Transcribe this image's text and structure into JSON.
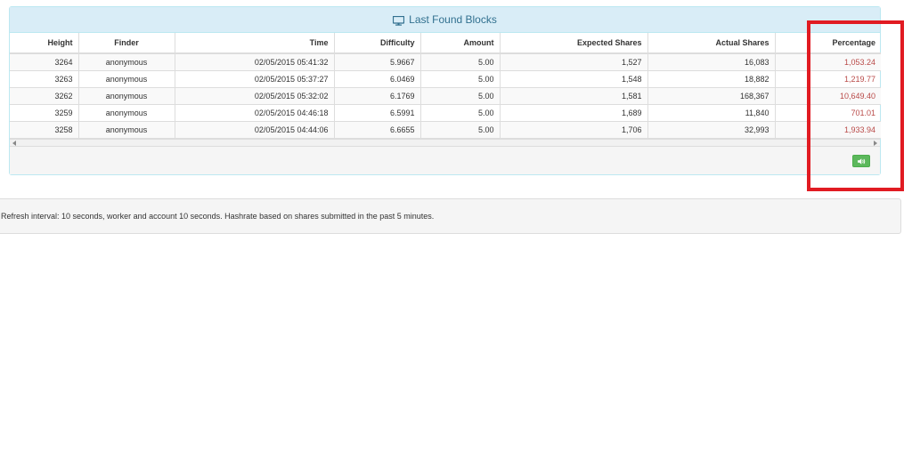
{
  "panel": {
    "title": "Last Found Blocks",
    "title_icon": "monitor-icon"
  },
  "table": {
    "columns": [
      "Height",
      "Finder",
      "Time",
      "Difficulty",
      "Amount",
      "Expected Shares",
      "Actual Shares",
      "Percentage"
    ],
    "rows": [
      {
        "height": "3264",
        "finder": "anonymous",
        "time": "02/05/2015 05:41:32",
        "difficulty": "5.9667",
        "amount": "5.00",
        "expected": "1,527",
        "actual": "16,083",
        "percentage": "1,053.24"
      },
      {
        "height": "3263",
        "finder": "anonymous",
        "time": "02/05/2015 05:37:27",
        "difficulty": "6.0469",
        "amount": "5.00",
        "expected": "1,548",
        "actual": "18,882",
        "percentage": "1,219.77"
      },
      {
        "height": "3262",
        "finder": "anonymous",
        "time": "02/05/2015 05:32:02",
        "difficulty": "6.1769",
        "amount": "5.00",
        "expected": "1,581",
        "actual": "168,367",
        "percentage": "10,649.40"
      },
      {
        "height": "3259",
        "finder": "anonymous",
        "time": "02/05/2015 04:46:18",
        "difficulty": "6.5991",
        "amount": "5.00",
        "expected": "1,689",
        "actual": "11,840",
        "percentage": "701.01"
      },
      {
        "height": "3258",
        "finder": "anonymous",
        "time": "02/05/2015 04:44:06",
        "difficulty": "6.6655",
        "amount": "5.00",
        "expected": "1,706",
        "actual": "32,993",
        "percentage": "1,933.94"
      }
    ]
  },
  "sound_button": {
    "icon": "speaker-icon"
  },
  "footer": {
    "text": "Refresh interval: 10 seconds, worker and account 10 seconds. Hashrate based on shares submitted in the past 5 minutes."
  },
  "colors": {
    "panel_heading_bg": "#d9edf7",
    "panel_heading_text": "#31708f",
    "percentage_text": "#b94a48",
    "highlight": "#e11b22",
    "button_green": "#5cb85c"
  }
}
